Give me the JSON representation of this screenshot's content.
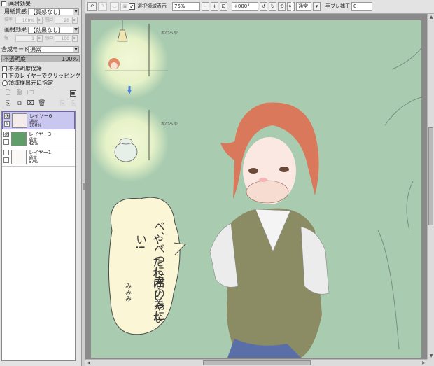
{
  "panel": {
    "material_effect_title": "画材効果",
    "paper_label": "用紙質感",
    "paper_value": "【質感なし】",
    "paper_scale_label": "倍率",
    "paper_scale_value": "100%",
    "paper_strength_label": "強さ",
    "paper_strength_value": "20",
    "material_label": "画材効果",
    "material_value": "【効果なし】",
    "material_width_label": "幅",
    "material_width_value": "1",
    "material_strength_label": "強さ",
    "material_strength_value": "100",
    "blend_label": "合成モード",
    "blend_value": "通常",
    "opacity_label": "不透明度",
    "opacity_value": "100%",
    "protect_label": "不透明度保護",
    "clip_label": "下のレイヤーでクリッピング",
    "selection_source_label": "領域検出元に指定"
  },
  "layers": [
    {
      "name": "レイヤー6",
      "mode": "通常",
      "opacity": "100%",
      "selected": true,
      "thumb": "#f4ecea"
    },
    {
      "name": "レイヤー3",
      "mode": "通常",
      "opacity": "42%",
      "selected": false,
      "thumb": "#5f9e68"
    },
    {
      "name": "レイヤー1",
      "mode": "通常",
      "opacity": "57%",
      "selected": false,
      "thumb": "#fbf8f8"
    }
  ],
  "toolbar": {
    "selection_display": "選択領域表示",
    "zoom": "75%",
    "rotation": "+000°",
    "blend_mode": "通常",
    "stabilizer_label": "手ブレ補正",
    "stabilizer_value": "0"
  },
  "artwork": {
    "balloon_text_line1": "ベ、べつに君の為に",
    "balloon_text_line2": "や、たわけじゃない!",
    "balloon_signature": "みみみ",
    "small_caption_top": "君のへや",
    "small_caption_bottom": "君のへや",
    "bg_color": "#a9ccb0"
  }
}
